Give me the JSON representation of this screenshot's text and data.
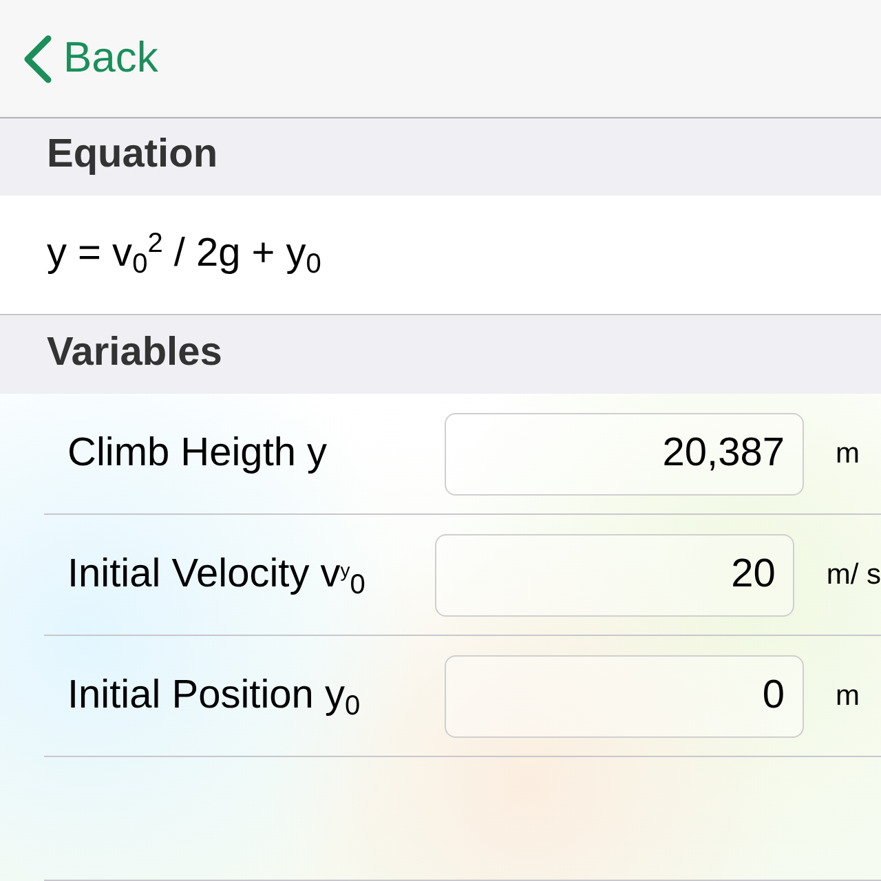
{
  "nav": {
    "back_label": "Back"
  },
  "equation_section": {
    "header": "Equation",
    "formula": "y = v$_{0}$$^{2}$ / 2g + y$_{0}$"
  },
  "variables_section": {
    "header": "Variables",
    "rows": [
      {
        "label": "Climb Heigth y",
        "value": "20,387",
        "unit": "m"
      },
      {
        "label": "Initial Velocity v$^{y}$$_{0}$",
        "value": "20",
        "unit": "m/ s"
      },
      {
        "label": "Initial Position y$_{0}$",
        "value": "0",
        "unit": "m"
      }
    ]
  }
}
